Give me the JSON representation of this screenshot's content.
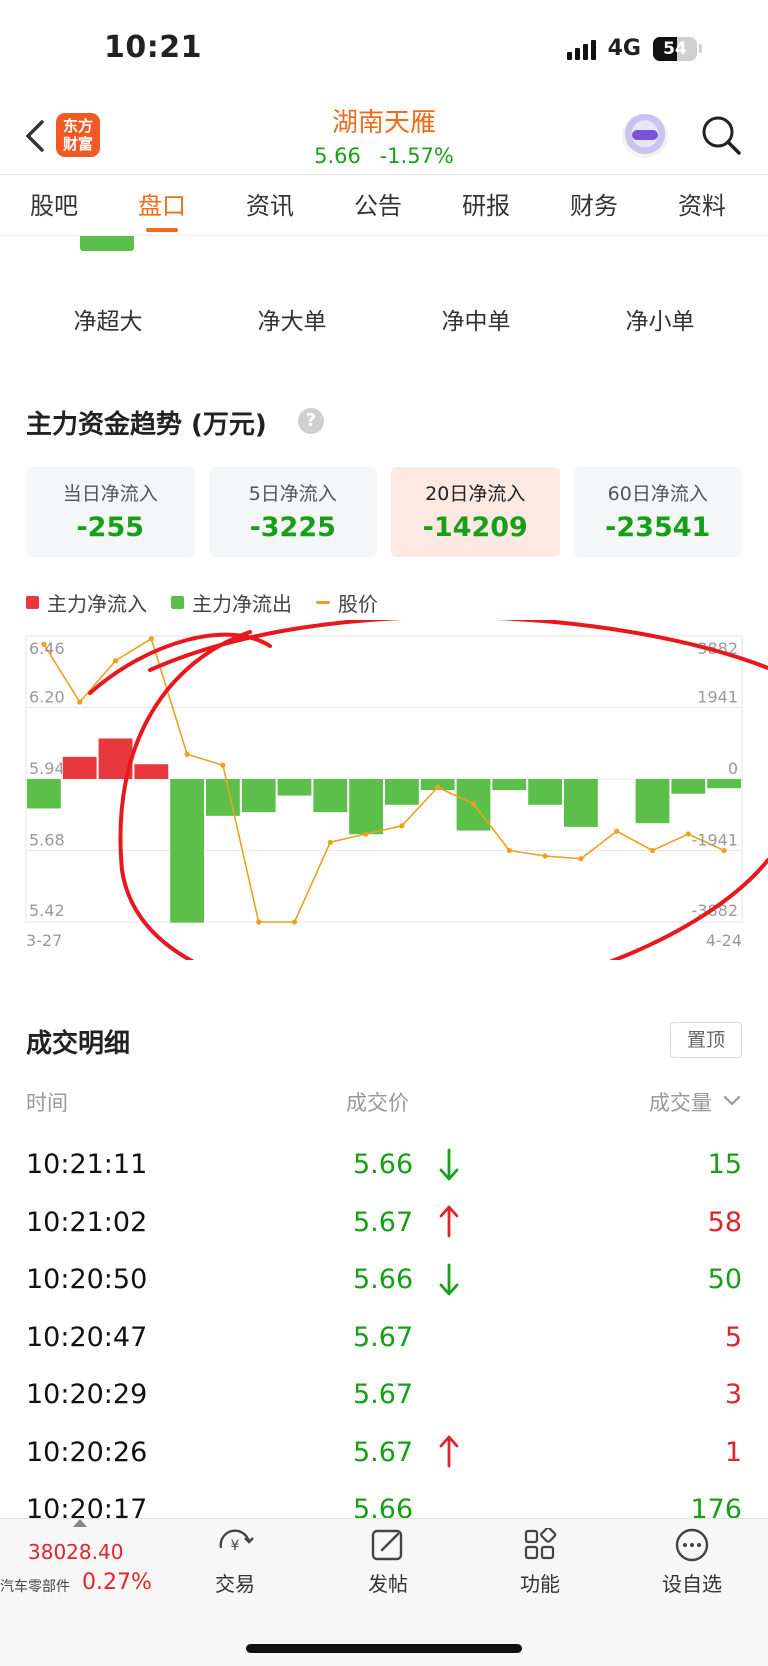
{
  "status": {
    "time": "10:21",
    "network": "4G",
    "battery": "54"
  },
  "header": {
    "logo_text": "东方财富",
    "title": "湖南天雁",
    "price": "5.66",
    "change_pct": "-1.57%"
  },
  "tabs": [
    "股吧",
    "盘口",
    "资讯",
    "公告",
    "研报",
    "财务",
    "资料"
  ],
  "active_tab": "盘口",
  "flow_labels": [
    "净超大",
    "净大单",
    "净中单",
    "净小单"
  ],
  "section": {
    "title": "主力资金趋势 (万元)",
    "help": "?"
  },
  "cards": [
    {
      "label": "当日净流入",
      "value": "-255"
    },
    {
      "label": "5日净流入",
      "value": "-3225"
    },
    {
      "label": "20日净流入",
      "value": "-14209"
    },
    {
      "label": "60日净流入",
      "value": "-23541"
    }
  ],
  "legend": {
    "inflow": "主力净流入",
    "outflow": "主力净流出",
    "price": "股价"
  },
  "colors": {
    "up": "#e8383d",
    "down": "#5cbf4a",
    "price_line": "#f0a020",
    "accent": "#f26b1d"
  },
  "chart_data": {
    "type": "bar",
    "left_axis_ticks": [
      "6.46",
      "6.20",
      "5.94",
      "5.68",
      "5.42"
    ],
    "right_axis_ticks": [
      "3882",
      "1941",
      "0",
      "-1941",
      "-3882"
    ],
    "x_start_label": "3-27",
    "x_end_label": "4-24",
    "ylim_price": [
      5.42,
      6.46
    ],
    "ylim_flow": [
      -3882,
      3882
    ],
    "series": [
      {
        "name": "主力净流入/主力净流出",
        "values": [
          -800,
          600,
          1100,
          400,
          -3900,
          -1000,
          -900,
          -450,
          -900,
          -1500,
          -700,
          -300,
          -1400,
          -300,
          -700,
          -1300,
          0,
          -1200,
          -400,
          -250
        ]
      },
      {
        "name": "股价",
        "values": [
          6.43,
          6.22,
          6.37,
          6.45,
          6.03,
          5.99,
          5.42,
          5.42,
          5.71,
          5.74,
          5.77,
          5.91,
          5.85,
          5.68,
          5.66,
          5.65,
          5.75,
          5.68,
          5.74,
          5.68
        ]
      }
    ],
    "grid": true
  },
  "deals": {
    "title": "成交明细",
    "pin_label": "置顶",
    "col_time": "时间",
    "col_price": "成交价",
    "col_volume": "成交量",
    "rows": [
      {
        "time": "10:21:11",
        "price": "5.66",
        "dir": "down",
        "volume": "15"
      },
      {
        "time": "10:21:02",
        "price": "5.67",
        "dir": "up",
        "volume": "58"
      },
      {
        "time": "10:20:50",
        "price": "5.66",
        "dir": "down",
        "volume": "50"
      },
      {
        "time": "10:20:47",
        "price": "5.67",
        "dir": "none",
        "volume": "5"
      },
      {
        "time": "10:20:29",
        "price": "5.67",
        "dir": "none",
        "volume": "3"
      },
      {
        "time": "10:20:26",
        "price": "5.67",
        "dir": "up",
        "volume": "1"
      },
      {
        "time": "10:20:17",
        "price": "5.66",
        "dir": "none",
        "volume": "176"
      }
    ]
  },
  "bottom": {
    "index_value": "38028.40",
    "index_name": "汽车零部件",
    "index_pct": "0.27%",
    "nav": [
      "交易",
      "发帖",
      "功能",
      "设自选"
    ]
  }
}
